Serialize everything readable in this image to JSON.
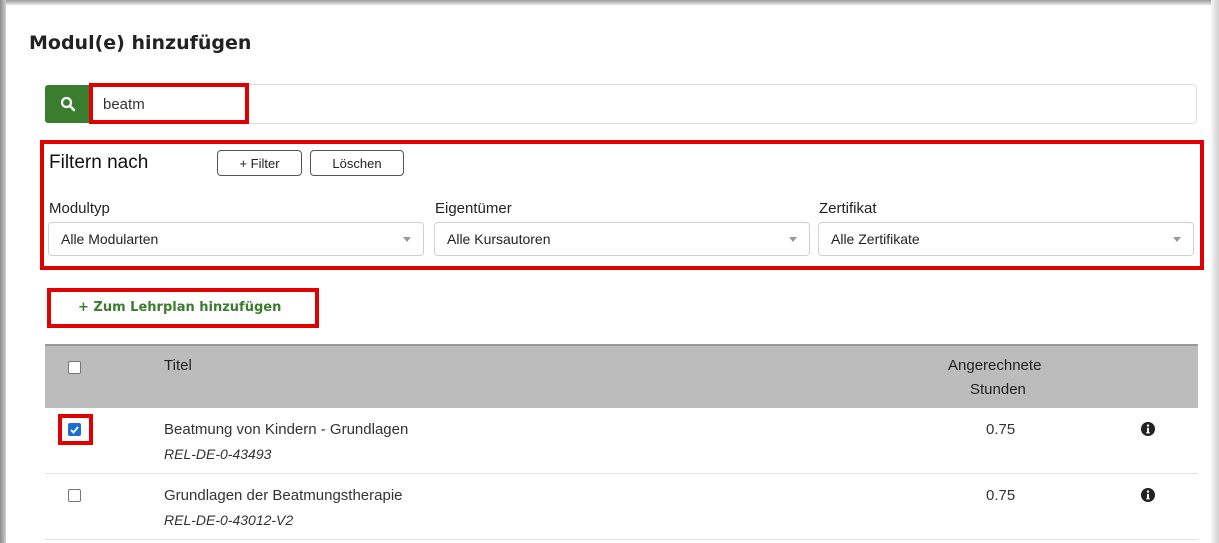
{
  "header": {
    "title": "Modul(e) hinzufügen"
  },
  "search": {
    "icon": "search-icon",
    "value": "beatm"
  },
  "filters": {
    "heading": "Filtern nach",
    "add_filter_label": "+ Filter",
    "clear_label": "Löschen",
    "fields": [
      {
        "label": "Modultyp",
        "selected": "Alle Modularten"
      },
      {
        "label": "Eigentümer",
        "selected": "Alle Kursautoren"
      },
      {
        "label": "Zertifikat",
        "selected": "Alle Zertifikate"
      }
    ]
  },
  "actions": {
    "add_to_curriculum_label": "+ Zum Lehrplan hinzufügen"
  },
  "table": {
    "columns": {
      "title": "Titel",
      "hours_line1": "Angerechnete",
      "hours_line2": "Stunden"
    },
    "rows": [
      {
        "title": "Beatmung von Kindern - Grundlagen",
        "code": "REL-DE-0-43493",
        "hours": "0.75",
        "checked": true
      },
      {
        "title": "Grundlagen der Beatmungstherapie",
        "code": "REL-DE-0-43012-V2",
        "hours": "0.75",
        "checked": false
      }
    ]
  },
  "colors": {
    "accent_green": "#3a7d2e",
    "highlight_red": "#e00000",
    "checkbox_blue": "#1a6fd1",
    "header_gray": "#bcbcbc"
  }
}
